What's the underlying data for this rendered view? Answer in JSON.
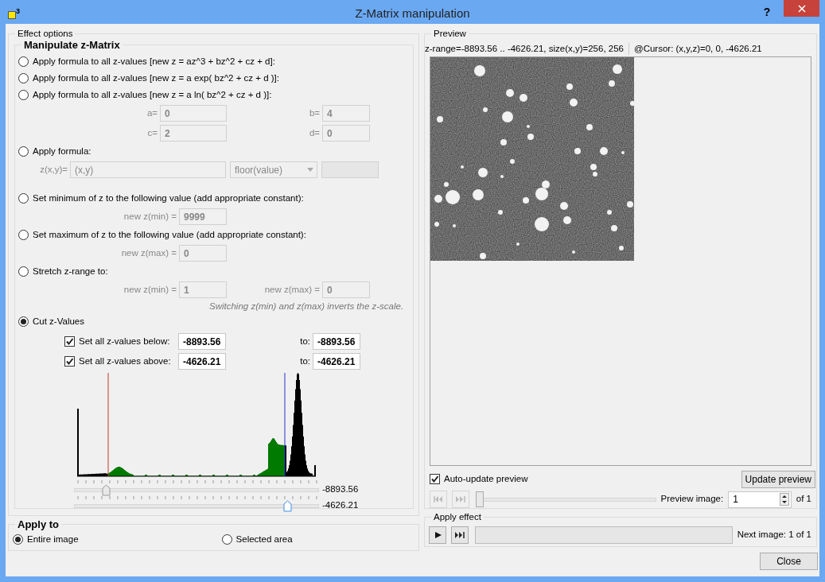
{
  "window": {
    "title": "Z-Matrix manipulation",
    "icon_mark": "3",
    "help": "?"
  },
  "effect_options": {
    "title": "Effect options",
    "manipulate": {
      "title": "Manipulate z-Matrix",
      "options": [
        {
          "kind": "plain",
          "label": "Apply formula to all z-values [new z = az^3 + bz^2 + cz + d]:",
          "selected": false
        },
        {
          "kind": "plain",
          "label": "Apply formula to all z-values [new z = a exp( bz^2 + cz + d )]:",
          "selected": false
        },
        {
          "kind": "params",
          "label": "Apply formula to all z-values [new z = a ln( bz^2 + cz + d )]:",
          "selected": false,
          "params": [
            {
              "label": "a=",
              "value": "0"
            },
            {
              "label": "b=",
              "value": "4"
            },
            {
              "label": "c=",
              "value": "2"
            },
            {
              "label": "d=",
              "value": "0"
            }
          ]
        },
        {
          "kind": "custom",
          "label": "Apply formula:",
          "selected": false,
          "field_label": "z(x,y)=",
          "value": "(x,y)",
          "dropdown": "floor(value)"
        },
        {
          "kind": "single",
          "label": "Set minimum of z to the following value (add appropriate constant):",
          "selected": false,
          "params": [
            {
              "label": "new z(min) =",
              "value": "9999"
            }
          ]
        },
        {
          "kind": "single",
          "label": "Set maximum of z to the following value (add appropriate constant):",
          "selected": false,
          "params": [
            {
              "label": "new z(max) =",
              "value": "0"
            }
          ]
        },
        {
          "kind": "single",
          "label": "Stretch z-range to:",
          "selected": false,
          "params": [
            {
              "label": "new z(min) =",
              "value": "1"
            },
            {
              "label": "new z(max) =",
              "value": "0"
            }
          ],
          "note": "Switching z(min) and z(max) inverts the z-scale."
        },
        {
          "kind": "cut",
          "label": "Cut z-Values",
          "selected": true,
          "rows": [
            {
              "label": "Set all z-values below:",
              "checked": true,
              "value": "-8893.56",
              "to_label": "to:",
              "to_value": "-8893.56"
            },
            {
              "label": "Set all z-values above:",
              "checked": true,
              "value": "-4626.21",
              "to_label": "to:",
              "to_value": "-4626.21"
            }
          ],
          "sliders": [
            {
              "level": 0.13,
              "reading": "-8893.56"
            },
            {
              "level": 0.87,
              "reading": "-4626.21"
            }
          ]
        }
      ]
    }
  },
  "apply_to": {
    "title": "Apply to",
    "options": [
      {
        "label": "Entire image",
        "selected": true
      },
      {
        "label": "Selected area",
        "selected": false
      }
    ]
  },
  "preview": {
    "title": "Preview",
    "info": "z-range=-8893.56 .. -4626.21, size(x,y)=256, 256",
    "cursor": "@Cursor: (x,y,z)=0, 0, -4626.21",
    "auto_update": {
      "label": "Auto-update preview",
      "checked": true
    },
    "update_button": "Update preview",
    "slider": {
      "level": 0
    },
    "image_label": "Preview image:",
    "image_value": "1",
    "of_label": "of 1"
  },
  "apply_effect": {
    "title": "Apply effect",
    "progress": {
      "level": 0
    },
    "next": "Next image: 1 of 1"
  },
  "close_button": "Close"
}
